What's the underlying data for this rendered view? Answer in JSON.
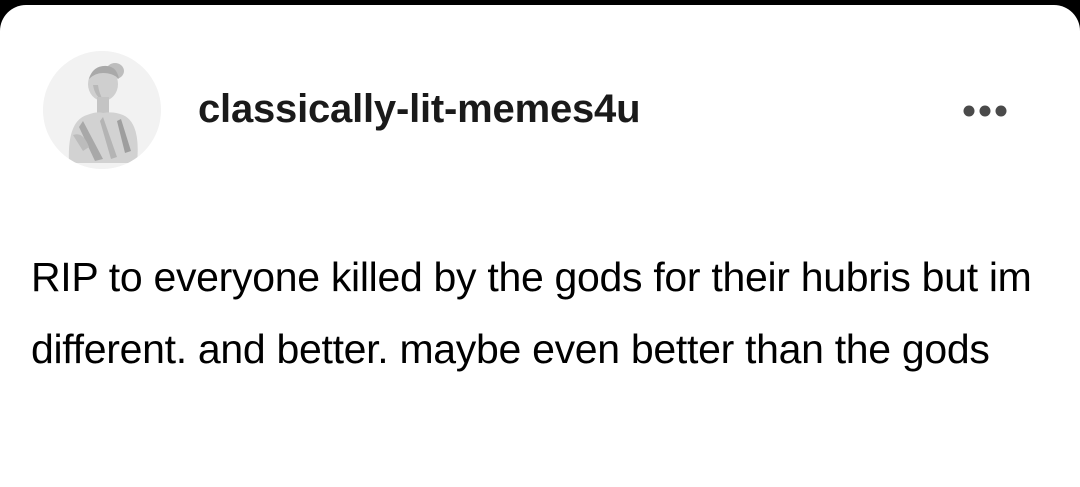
{
  "post": {
    "avatar_icon": "classical-bust-icon",
    "username": "classically-lit-memes4u",
    "more_icon": "ellipsis-icon",
    "body_text": "RIP to everyone killed by the gods for their hubris but im different. and better. maybe even better than the gods"
  },
  "colors": {
    "background": "#000000",
    "card": "#ffffff",
    "text": "#000000",
    "username": "#1a1a1a",
    "icon": "#4a4a4a"
  }
}
